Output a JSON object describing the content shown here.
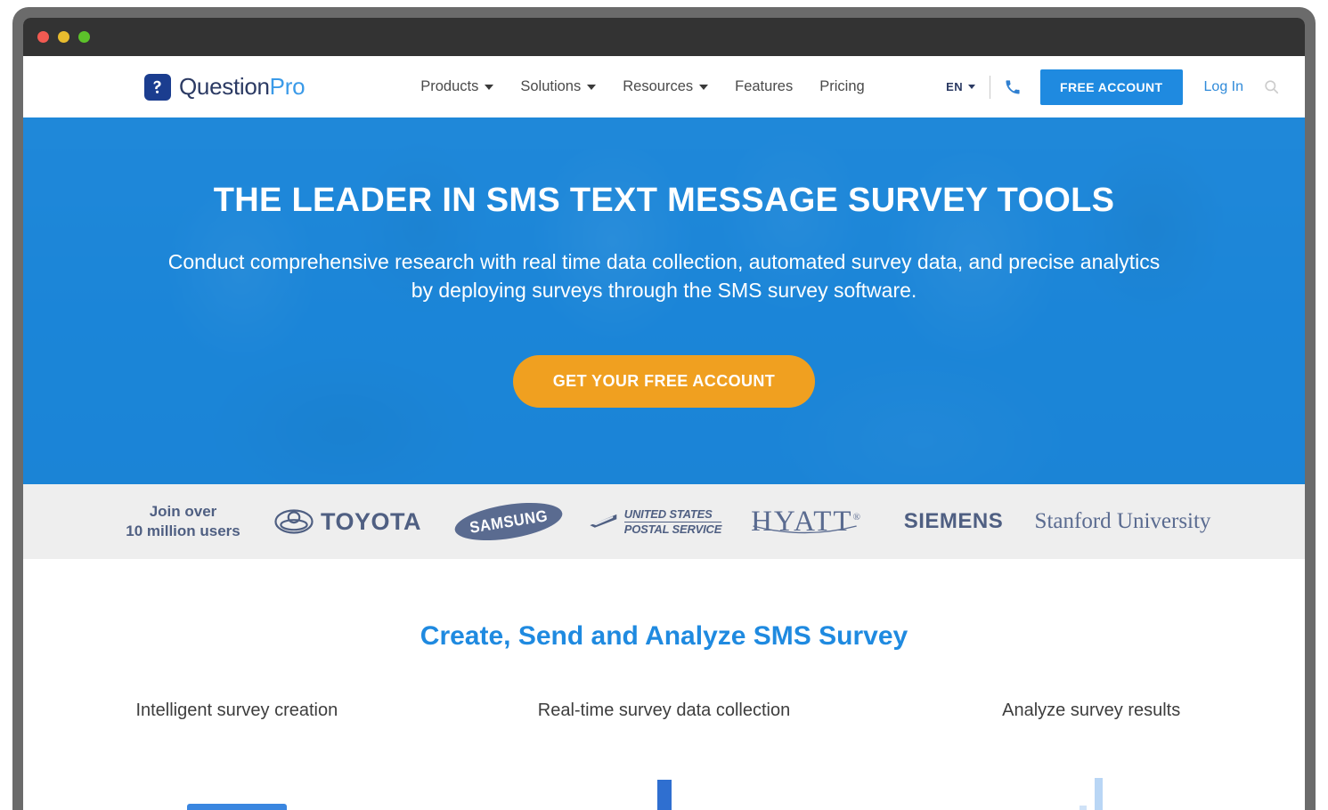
{
  "window": {
    "controls": [
      "close",
      "minimize",
      "maximize"
    ]
  },
  "header": {
    "brand": {
      "mark": "questionpro-logo-icon",
      "name_part1": "Question",
      "name_part2": "Pro"
    },
    "nav_items": [
      {
        "label": "Products",
        "has_dropdown": true
      },
      {
        "label": "Solutions",
        "has_dropdown": true
      },
      {
        "label": "Resources",
        "has_dropdown": true
      },
      {
        "label": "Features",
        "has_dropdown": false
      },
      {
        "label": "Pricing",
        "has_dropdown": false
      }
    ],
    "language": "EN",
    "phone_icon": "phone-icon",
    "free_account_label": "FREE ACCOUNT",
    "login_label": "Log In",
    "search_icon": "search-icon"
  },
  "hero": {
    "title": "THE LEADER IN SMS TEXT MESSAGE SURVEY TOOLS",
    "subtitle": "Conduct comprehensive research with real time data collection, automated survey data, and precise analytics by deploying surveys through the SMS survey software.",
    "cta_label": "GET YOUR FREE ACCOUNT"
  },
  "logos_bar": {
    "join_line1": "Join over",
    "join_line2": "10 million users",
    "brands": [
      {
        "name": "TOYOTA",
        "icon": "toyota-logo-icon"
      },
      {
        "name": "SAMSUNG",
        "icon": "samsung-logo-icon"
      },
      {
        "name": "UNITED STATES POSTAL SERVICE",
        "line1": "UNITED STATES",
        "line2": "POSTAL SERVICE",
        "icon": "usps-logo-icon"
      },
      {
        "name": "HYATT",
        "icon": "hyatt-logo-icon",
        "registered": "®"
      },
      {
        "name": "SIEMENS",
        "icon": "siemens-logo-icon"
      },
      {
        "name": "Stanford University",
        "icon": "stanford-logo-icon"
      }
    ]
  },
  "features": {
    "title": "Create, Send and Analyze SMS Survey",
    "columns": [
      {
        "label": "Intelligent survey creation"
      },
      {
        "label": "Real-time survey data collection"
      },
      {
        "label": "Analyze survey results"
      }
    ]
  },
  "colors": {
    "brand_blue": "#1f8ae0",
    "brand_navy": "#1b3d8f",
    "cta_orange": "#f0a020",
    "logos_bg": "#eeeeee",
    "frame_gray": "#6b6b6b",
    "titlebar": "#333333",
    "logo_slate": "#4f5f82"
  }
}
